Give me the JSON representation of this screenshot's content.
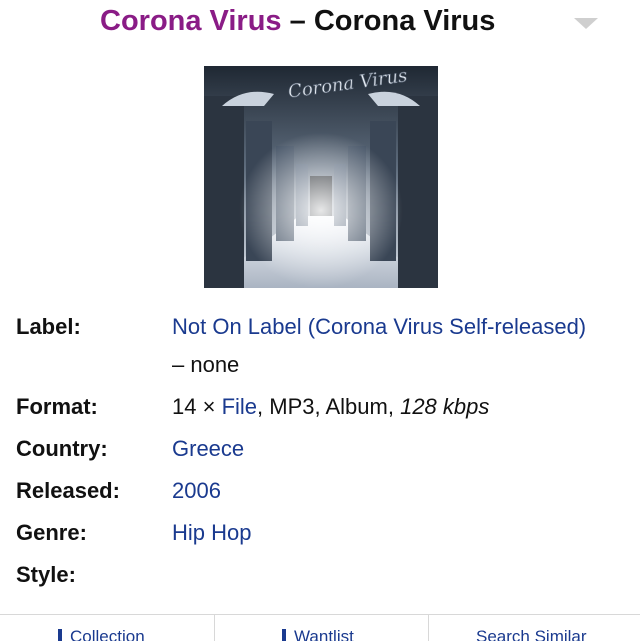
{
  "header": {
    "artist": "Corona Virus",
    "separator": "–",
    "album": "Corona Virus",
    "colors": {
      "artist": "#8a1c86",
      "text": "#111111",
      "link": "#1a3a8f"
    }
  },
  "cover": {
    "icon": "album-cover-image",
    "logo_text": "Corona Virus"
  },
  "details": {
    "label": {
      "key": "Label:",
      "value": "Not On Label (Corona Virus Self-released)",
      "suffix": "– none"
    },
    "format": {
      "key": "Format:",
      "prefix": "14 ×",
      "file": "File",
      "rest": ", MP3, Album, ",
      "bitrate": "128 kbps"
    },
    "country": {
      "key": "Country:",
      "value": "Greece"
    },
    "released": {
      "key": "Released:",
      "value": "2006"
    },
    "genre": {
      "key": "Genre:",
      "value": "Hip Hop"
    },
    "style": {
      "key": "Style:",
      "value": ""
    }
  },
  "bottom_bar": {
    "collection": "Collection",
    "wantlist": "Wantlist",
    "search_similar": "Search Similar"
  }
}
